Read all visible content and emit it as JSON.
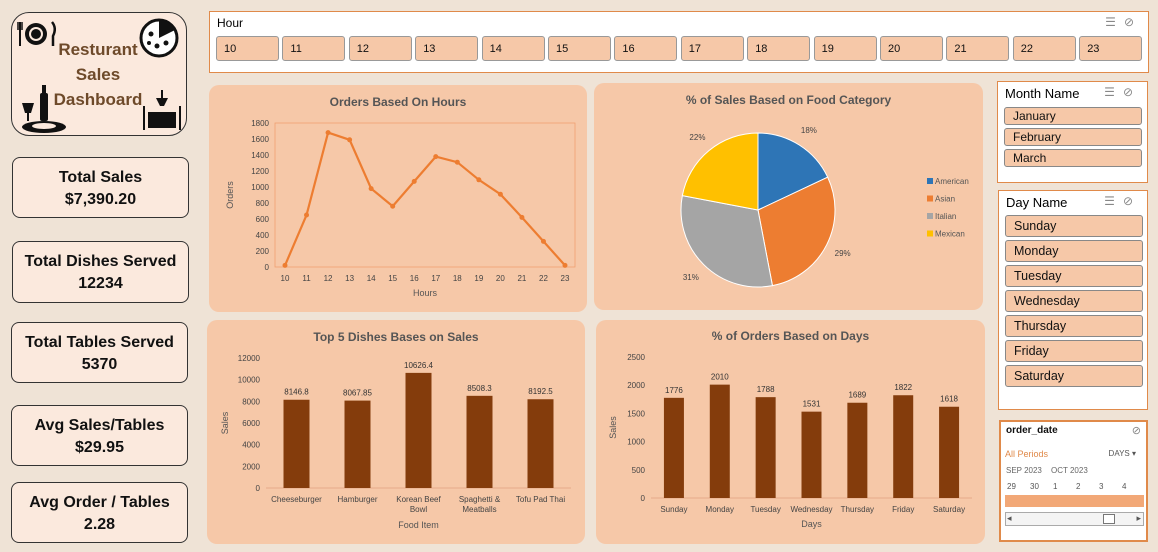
{
  "logo": {
    "line1": "Resturant",
    "line2": "Sales",
    "line3": "Dashboard"
  },
  "kpis": [
    {
      "label": "Total Sales",
      "value": "$7,390.20"
    },
    {
      "label": "Total Dishes Served",
      "value": "12234"
    },
    {
      "label": "Total Tables Served",
      "value": "5370"
    },
    {
      "label": "Avg Sales/Tables",
      "value": "$29.95"
    },
    {
      "label": "Avg Order / Tables",
      "value": "2.28"
    }
  ],
  "hour_slicer": {
    "title": "Hour",
    "items": [
      "10",
      "11",
      "12",
      "13",
      "14",
      "15",
      "16",
      "17",
      "18",
      "19",
      "20",
      "21",
      "22",
      "23"
    ]
  },
  "month_slicer": {
    "title": "Month Name",
    "items": [
      "January",
      "February",
      "March"
    ]
  },
  "day_slicer": {
    "title": "Day Name",
    "items": [
      "Sunday",
      "Monday",
      "Tuesday",
      "Wednesday",
      "Thursday",
      "Friday",
      "Saturday"
    ]
  },
  "timeline": {
    "title": "order_date",
    "period": "All Periods",
    "unit": "DAYS",
    "month1": "SEP 2023",
    "month2": "OCT 2023",
    "days": [
      "29",
      "30",
      "1",
      "2",
      "3",
      "4"
    ]
  },
  "colors": {
    "accent": "#e08a4a",
    "panel": "#f6c8a8",
    "bar": "#843c0c",
    "line": "#ed7d31"
  },
  "chart_data": [
    {
      "type": "line",
      "title": "Orders Based On Hours",
      "xlabel": "Hours",
      "ylabel": "Orders",
      "x": [
        "10",
        "11",
        "12",
        "13",
        "14",
        "15",
        "16",
        "17",
        "18",
        "19",
        "20",
        "21",
        "22",
        "23"
      ],
      "values": [
        20,
        650,
        1680,
        1590,
        980,
        760,
        1070,
        1380,
        1310,
        1090,
        910,
        620,
        320,
        20
      ],
      "yticks": [
        "0",
        "200",
        "400",
        "600",
        "800",
        "1000",
        "1200",
        "1400",
        "1600",
        "1800"
      ],
      "ylim": [
        0,
        1800
      ],
      "grid": false
    },
    {
      "type": "pie",
      "title": "% of Sales Based on Food Category",
      "slices": [
        {
          "name": "American",
          "value": 18,
          "label": "18%",
          "color": "#2e75b6"
        },
        {
          "name": "Asian",
          "value": 29,
          "label": "29%",
          "color": "#ed7d31"
        },
        {
          "name": "Italian",
          "value": 31,
          "label": "31%",
          "color": "#a5a5a5"
        },
        {
          "name": "Mexican",
          "value": 22,
          "label": "22%",
          "color": "#ffc000"
        }
      ],
      "legend": "right"
    },
    {
      "type": "bar",
      "title": "Top 5 Dishes Bases on Sales",
      "xlabel": "Food Item",
      "ylabel": "Sales",
      "categories": [
        [
          "Cheeseburger"
        ],
        [
          "Hamburger"
        ],
        [
          "Korean Beef",
          "Bowl"
        ],
        [
          "Spaghetti &",
          "Meatballs"
        ],
        [
          "Tofu Pad Thai"
        ]
      ],
      "values": [
        8146.8,
        8067.85,
        10626.4,
        8508.3,
        8192.5
      ],
      "labels": [
        "8146.8",
        "8067.85",
        "10626.4",
        "8508.3",
        "8192.5"
      ],
      "yticks": [
        "0",
        "2000",
        "4000",
        "6000",
        "8000",
        "10000",
        "12000"
      ],
      "ylim": [
        0,
        12000
      ]
    },
    {
      "type": "bar",
      "title": "% of Orders Based on Days",
      "xlabel": "Days",
      "ylabel": "Sales",
      "categories": [
        [
          "Sunday"
        ],
        [
          "Monday"
        ],
        [
          "Tuesday"
        ],
        [
          "Wednesday"
        ],
        [
          "Thursday"
        ],
        [
          "Friday"
        ],
        [
          "Saturday"
        ]
      ],
      "values": [
        1776,
        2010,
        1788,
        1531,
        1689,
        1822,
        1618
      ],
      "labels": [
        "1776",
        "2010",
        "1788",
        "1531",
        "1689",
        "1822",
        "1618"
      ],
      "yticks": [
        "0",
        "500",
        "1000",
        "1500",
        "2000",
        "2500"
      ],
      "ylim": [
        0,
        2500
      ]
    }
  ]
}
